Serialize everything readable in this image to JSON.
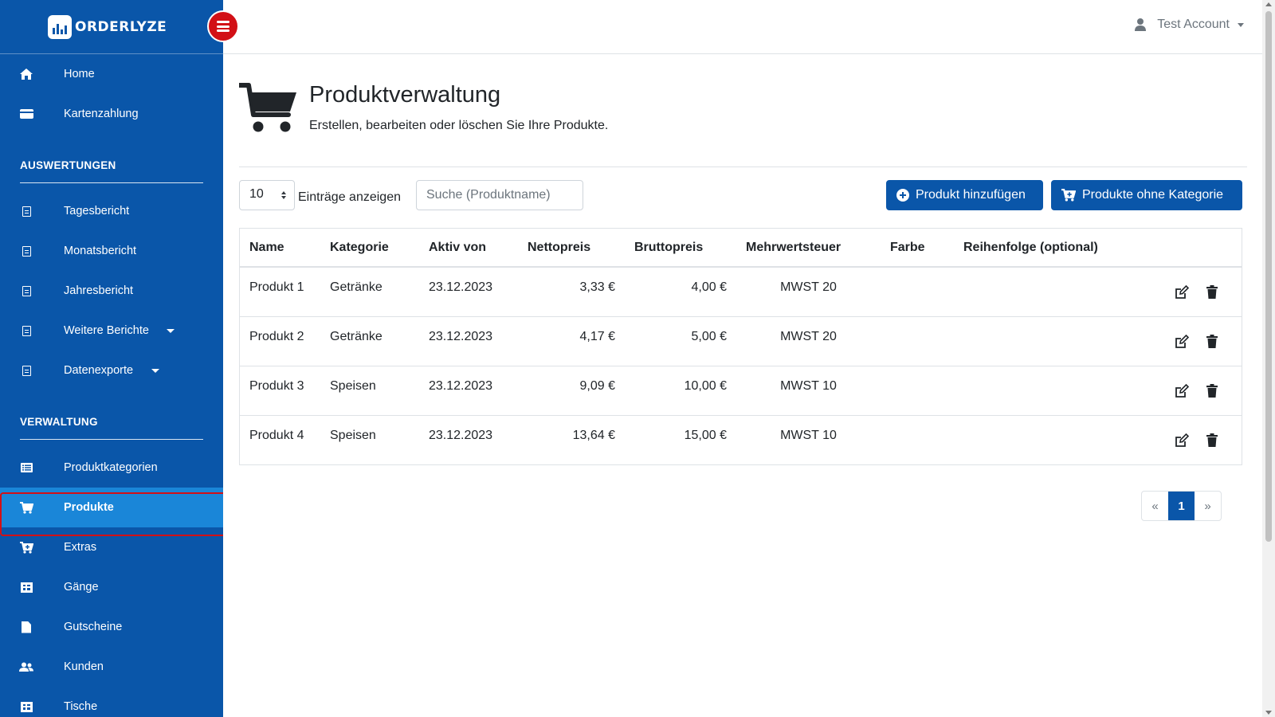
{
  "brand": {
    "name": "ORDERLYZE"
  },
  "user": {
    "name": "Test Account"
  },
  "sidebar": {
    "items_top": [
      {
        "label": "Home",
        "icon": "home-icon"
      },
      {
        "label": "Kartenzahlung",
        "icon": "credit-card-icon"
      }
    ],
    "section_reports": "AUSWERTUNGEN",
    "reports": [
      {
        "label": "Tagesbericht",
        "icon": "file-icon"
      },
      {
        "label": "Monatsbericht",
        "icon": "file-icon"
      },
      {
        "label": "Jahresbericht",
        "icon": "file-icon"
      },
      {
        "label": "Weitere Berichte",
        "icon": "file-icon"
      },
      {
        "label": "Datenexporte",
        "icon": "file-icon"
      }
    ],
    "section_admin": "VERWALTUNG",
    "admin": [
      {
        "label": "Produktkategorien",
        "icon": "list-icon"
      },
      {
        "label": "Produkte",
        "icon": "cart-icon"
      },
      {
        "label": "Extras",
        "icon": "cart-plus-icon"
      },
      {
        "label": "Gänge",
        "icon": "table-icon"
      },
      {
        "label": "Gutscheine",
        "icon": "file-icon"
      },
      {
        "label": "Kunden",
        "icon": "users-icon"
      },
      {
        "label": "Tische",
        "icon": "table-icon"
      }
    ]
  },
  "page": {
    "title": "Produktverwaltung",
    "subtitle": "Erstellen, bearbeiten oder löschen Sie Ihre Produkte."
  },
  "controls": {
    "page_length": "10",
    "length_label": "Einträge anzeigen",
    "search_placeholder": "Suche (Produktname)",
    "add_button": "Produkt hinzufügen",
    "no_category_button": "Produkte ohne Kategorie"
  },
  "table": {
    "headers": {
      "name": "Name",
      "category": "Kategorie",
      "active_from": "Aktiv von",
      "net": "Nettopreis",
      "gross": "Bruttopreis",
      "vat": "Mehrwertsteuer",
      "color": "Farbe",
      "order": "Reihenfolge (optional)"
    },
    "rows": [
      {
        "name": "Produkt 1",
        "category": "Getränke",
        "active_from": "23.12.2023",
        "net": "3,33 €",
        "gross": "4,00 €",
        "vat": "MWST 20",
        "color": "",
        "order": ""
      },
      {
        "name": "Produkt 2",
        "category": "Getränke",
        "active_from": "23.12.2023",
        "net": "4,17 €",
        "gross": "5,00 €",
        "vat": "MWST 20",
        "color": "",
        "order": ""
      },
      {
        "name": "Produkt 3",
        "category": "Speisen",
        "active_from": "23.12.2023",
        "net": "9,09 €",
        "gross": "10,00 €",
        "vat": "MWST 10",
        "color": "",
        "order": ""
      },
      {
        "name": "Produkt 4",
        "category": "Speisen",
        "active_from": "23.12.2023",
        "net": "13,64 €",
        "gross": "15,00 €",
        "vat": "MWST 10",
        "color": "",
        "order": ""
      }
    ]
  },
  "pagination": {
    "prev": "«",
    "current": "1",
    "next": "»"
  },
  "colors": {
    "sidebar": "#0a56a9",
    "active": "#1a86d8",
    "toggle": "#d21016",
    "primary": "#0a56a9"
  }
}
